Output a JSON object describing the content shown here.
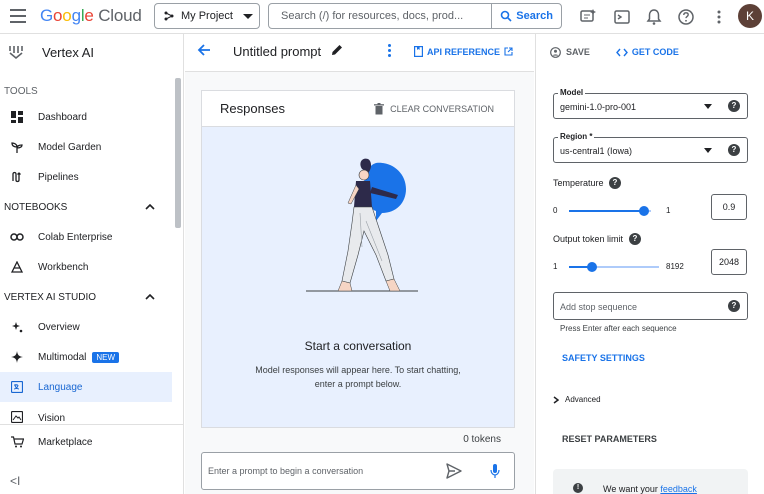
{
  "topbar": {
    "logo": {
      "google": [
        "G",
        "o",
        "o",
        "g",
        "l",
        "e"
      ],
      "cloud": "Cloud"
    },
    "project_label": "My Project",
    "search_placeholder": "Search (/) for resources, docs, prod...",
    "search_button": "Search",
    "avatar_initial": "K"
  },
  "sidebar": {
    "product_name": "Vertex AI",
    "tools_label": "TOOLS",
    "tools_items": [
      {
        "label": "Dashboard",
        "icon": "dashboard-icon"
      },
      {
        "label": "Model Garden",
        "icon": "model-garden-icon"
      },
      {
        "label": "Pipelines",
        "icon": "pipelines-icon"
      }
    ],
    "notebooks_label": "NOTEBOOKS",
    "notebooks_items": [
      {
        "label": "Colab Enterprise",
        "icon": "colab-icon"
      },
      {
        "label": "Workbench",
        "icon": "workbench-icon"
      }
    ],
    "studio_label": "VERTEX AI STUDIO",
    "studio_items": [
      {
        "label": "Overview",
        "icon": "overview-icon"
      },
      {
        "label": "Multimodal",
        "icon": "multimodal-icon",
        "badge": "NEW"
      },
      {
        "label": "Language",
        "icon": "language-icon",
        "active": true
      },
      {
        "label": "Vision",
        "icon": "vision-icon"
      }
    ],
    "marketplace_label": "Marketplace",
    "collapse_glyph": "<I"
  },
  "prompt_header": {
    "title": "Untitled prompt",
    "api_reference": "API REFERENCE"
  },
  "responses": {
    "title": "Responses",
    "clear_label": "CLEAR CONVERSATION",
    "empty_title": "Start a conversation",
    "empty_desc": "Model responses will appear here. To start chatting, enter a prompt below.",
    "tokens": "0 tokens",
    "input_placeholder": "Enter a prompt to begin a conversation"
  },
  "right_panel": {
    "save_label": "SAVE",
    "get_code_label": "GET CODE",
    "model_label": "Model",
    "model_value": "gemini-1.0-pro-001",
    "region_label": "Region *",
    "region_value": "us-central1 (Iowa)",
    "temperature_label": "Temperature",
    "temperature_min": "0",
    "temperature_max": "1",
    "temperature_value": "0.9",
    "token_limit_label": "Output token limit",
    "token_limit_min": "1",
    "token_limit_max": "8192",
    "token_limit_value": "2048",
    "stop_seq_placeholder": "Add stop sequence",
    "stop_seq_hint": "Press Enter after each sequence",
    "safety_label": "SAFETY SETTINGS",
    "advanced_label": "Advanced",
    "reset_label": "RESET PARAMETERS",
    "feedback_prefix": "We want your",
    "feedback_link": "feedback"
  },
  "colors": {
    "accent": "#1a73e8",
    "active_bg": "#e8f0fe",
    "figure_blue": "#1a73e8",
    "figure_dark": "#2d2a4a"
  }
}
